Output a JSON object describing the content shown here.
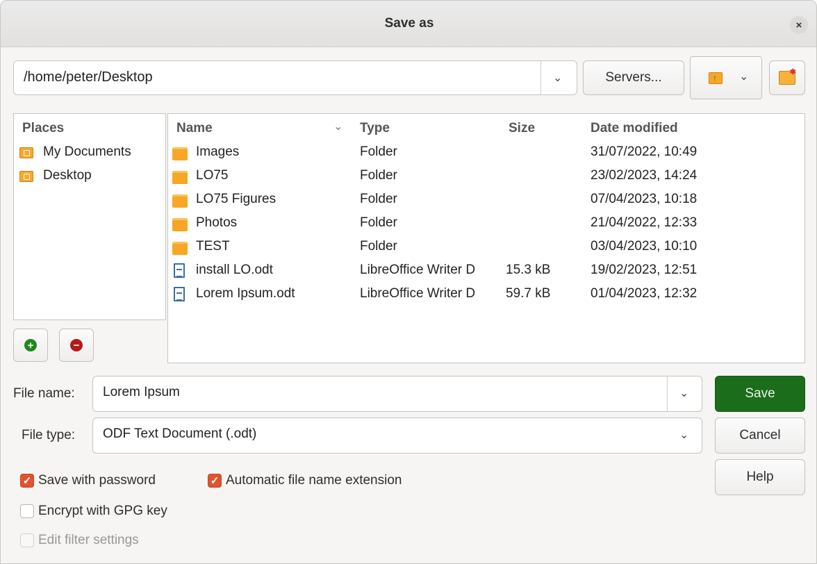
{
  "window": {
    "title": "Save as",
    "close_glyph": "×"
  },
  "toolbar": {
    "path": "/home/peter/Desktop",
    "servers_label": "Servers...",
    "new_folder_icon": "folder-up-icon",
    "new_dir_icon": "new-folder-icon"
  },
  "places": {
    "header": "Places",
    "items": [
      {
        "label": "My Documents",
        "icon": "place-folder-icon"
      },
      {
        "label": "Desktop",
        "icon": "place-folder-icon"
      }
    ],
    "add_icon": "add-icon",
    "remove_icon": "remove-icon"
  },
  "files": {
    "columns": {
      "name": "Name",
      "type": "Type",
      "size": "Size",
      "date": "Date modified"
    },
    "rows": [
      {
        "name": "Images",
        "type": "Folder",
        "size": "",
        "date": "31/07/2022, 10:49",
        "icon": "folder-icon"
      },
      {
        "name": "LO75",
        "type": "Folder",
        "size": "",
        "date": "23/02/2023, 14:24",
        "icon": "folder-icon"
      },
      {
        "name": "LO75 Figures",
        "type": "Folder",
        "size": "",
        "date": "07/04/2023, 10:18",
        "icon": "folder-icon"
      },
      {
        "name": "Photos",
        "type": "Folder",
        "size": "",
        "date": "21/04/2022, 12:33",
        "icon": "folder-icon"
      },
      {
        "name": "TEST",
        "type": "Folder",
        "size": "",
        "date": "03/04/2023, 10:10",
        "icon": "folder-icon"
      },
      {
        "name": "install LO.odt",
        "type": "LibreOffice Writer D",
        "size": "15.3 kB",
        "date": "19/02/2023, 12:51",
        "icon": "document-icon"
      },
      {
        "name": "Lorem Ipsum.odt",
        "type": "LibreOffice Writer D",
        "size": "59.7 kB",
        "date": "01/04/2023, 12:32",
        "icon": "document-icon"
      }
    ]
  },
  "form": {
    "file_name_label": "File name:",
    "file_name_value": "Lorem Ipsum",
    "file_type_label": "File type:",
    "file_type_value": "ODF Text Document (.odt)"
  },
  "buttons": {
    "save": "Save",
    "cancel": "Cancel",
    "help": "Help"
  },
  "options": {
    "save_with_password": {
      "label": "Save with password",
      "checked": true
    },
    "auto_extension": {
      "label": "Automatic file name extension",
      "checked": true
    },
    "encrypt_gpg": {
      "label": "Encrypt with GPG key",
      "checked": false
    },
    "edit_filter": {
      "label": "Edit filter settings",
      "checked": false,
      "disabled": true
    }
  },
  "colors": {
    "accent_check": "#e1542d",
    "save_button": "#1b6c1b"
  }
}
